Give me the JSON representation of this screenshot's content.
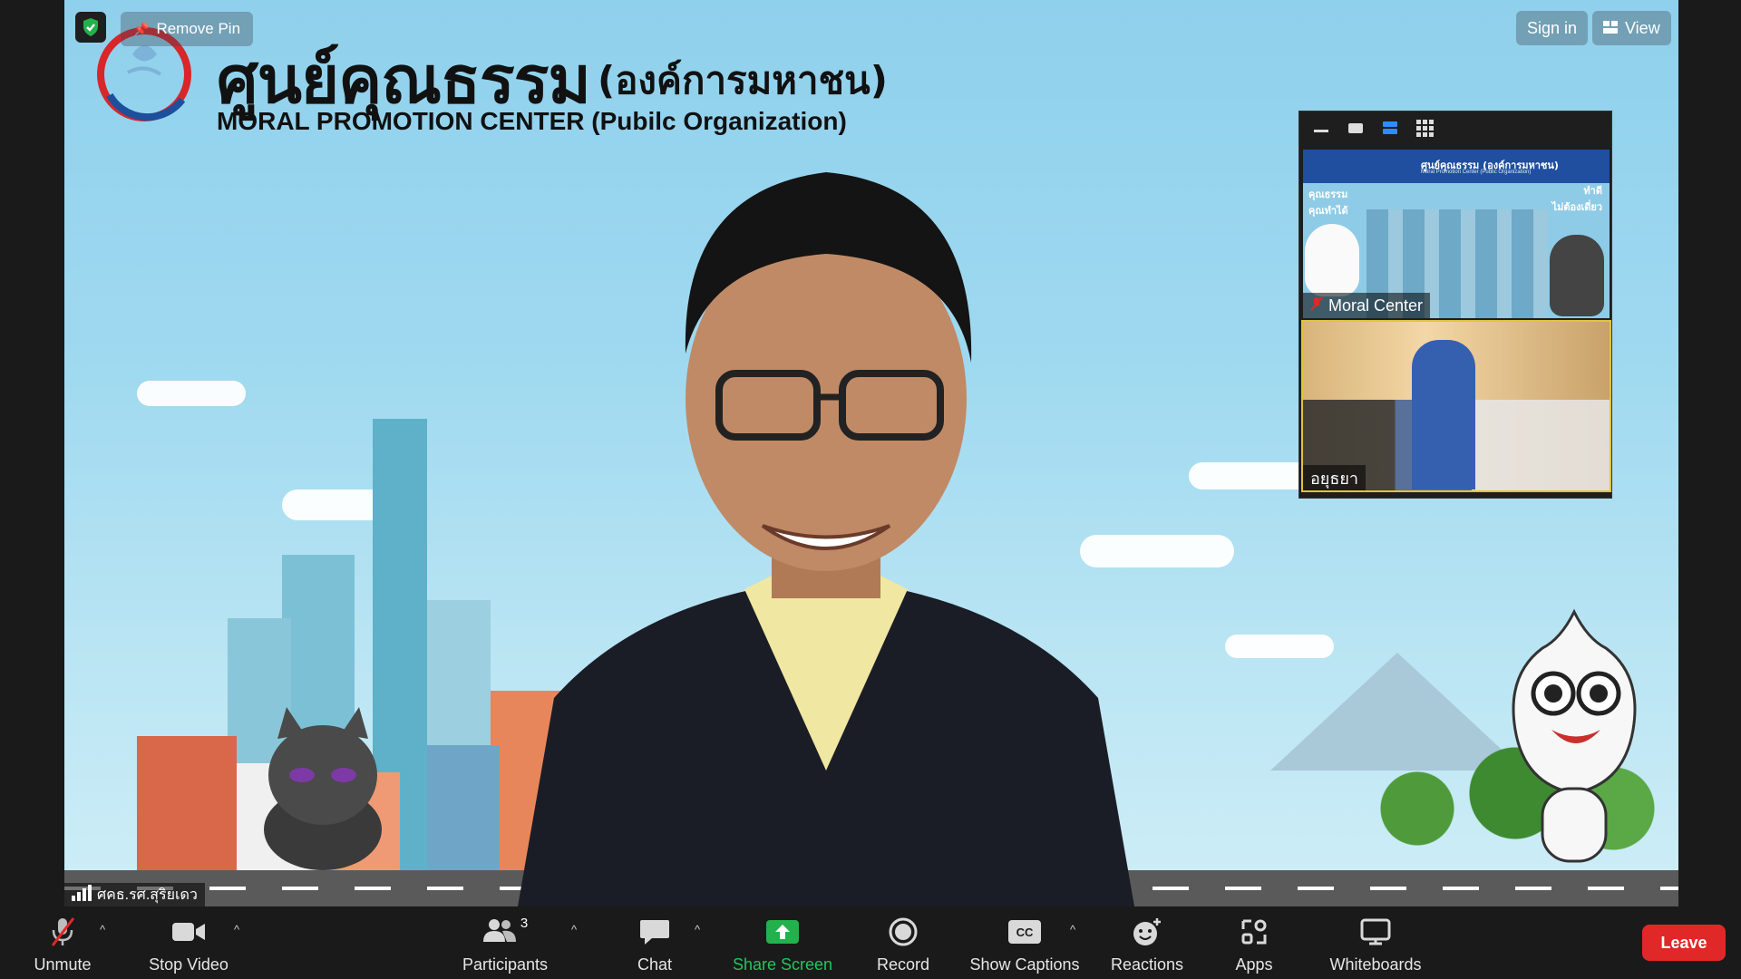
{
  "controls": {
    "remove_pin": "Remove Pin",
    "sign_in": "Sign in",
    "view": "View"
  },
  "background": {
    "title_th": "ศูนย์คุณธรรม",
    "title_th_sub": "(องค์การมหาชน)",
    "title_en": "MORAL PROMOTION CENTER  (Pubilc Organization)",
    "logo_caption": "ศูนย์คุณธรรม"
  },
  "speaker": {
    "name": "ศคธ.รศ.สุริยเดว"
  },
  "gallery": {
    "tiles": [
      {
        "name": "Moral Center",
        "header_th": "ศูนย์คุณธรรม (องค์การมหาชน)",
        "header_en": "Moral Promotion Center (Public Organization)",
        "left_text": "คุณธรรม\nคุณทำได้",
        "right_text": "ทำดี\nไม่ต้องเดี่ยว"
      },
      {
        "name": "อยุธยา"
      }
    ]
  },
  "toolbar": {
    "unmute": "Unmute",
    "stop_video": "Stop Video",
    "participants": "Participants",
    "participants_count": "3",
    "chat": "Chat",
    "share_screen": "Share Screen",
    "record": "Record",
    "show_captions": "Show Captions",
    "reactions": "Reactions",
    "apps": "Apps",
    "whiteboards": "Whiteboards",
    "leave": "Leave"
  },
  "colors": {
    "share_green": "#22b14c",
    "leave_red": "#e02828",
    "active_blue": "#2d8cff"
  }
}
